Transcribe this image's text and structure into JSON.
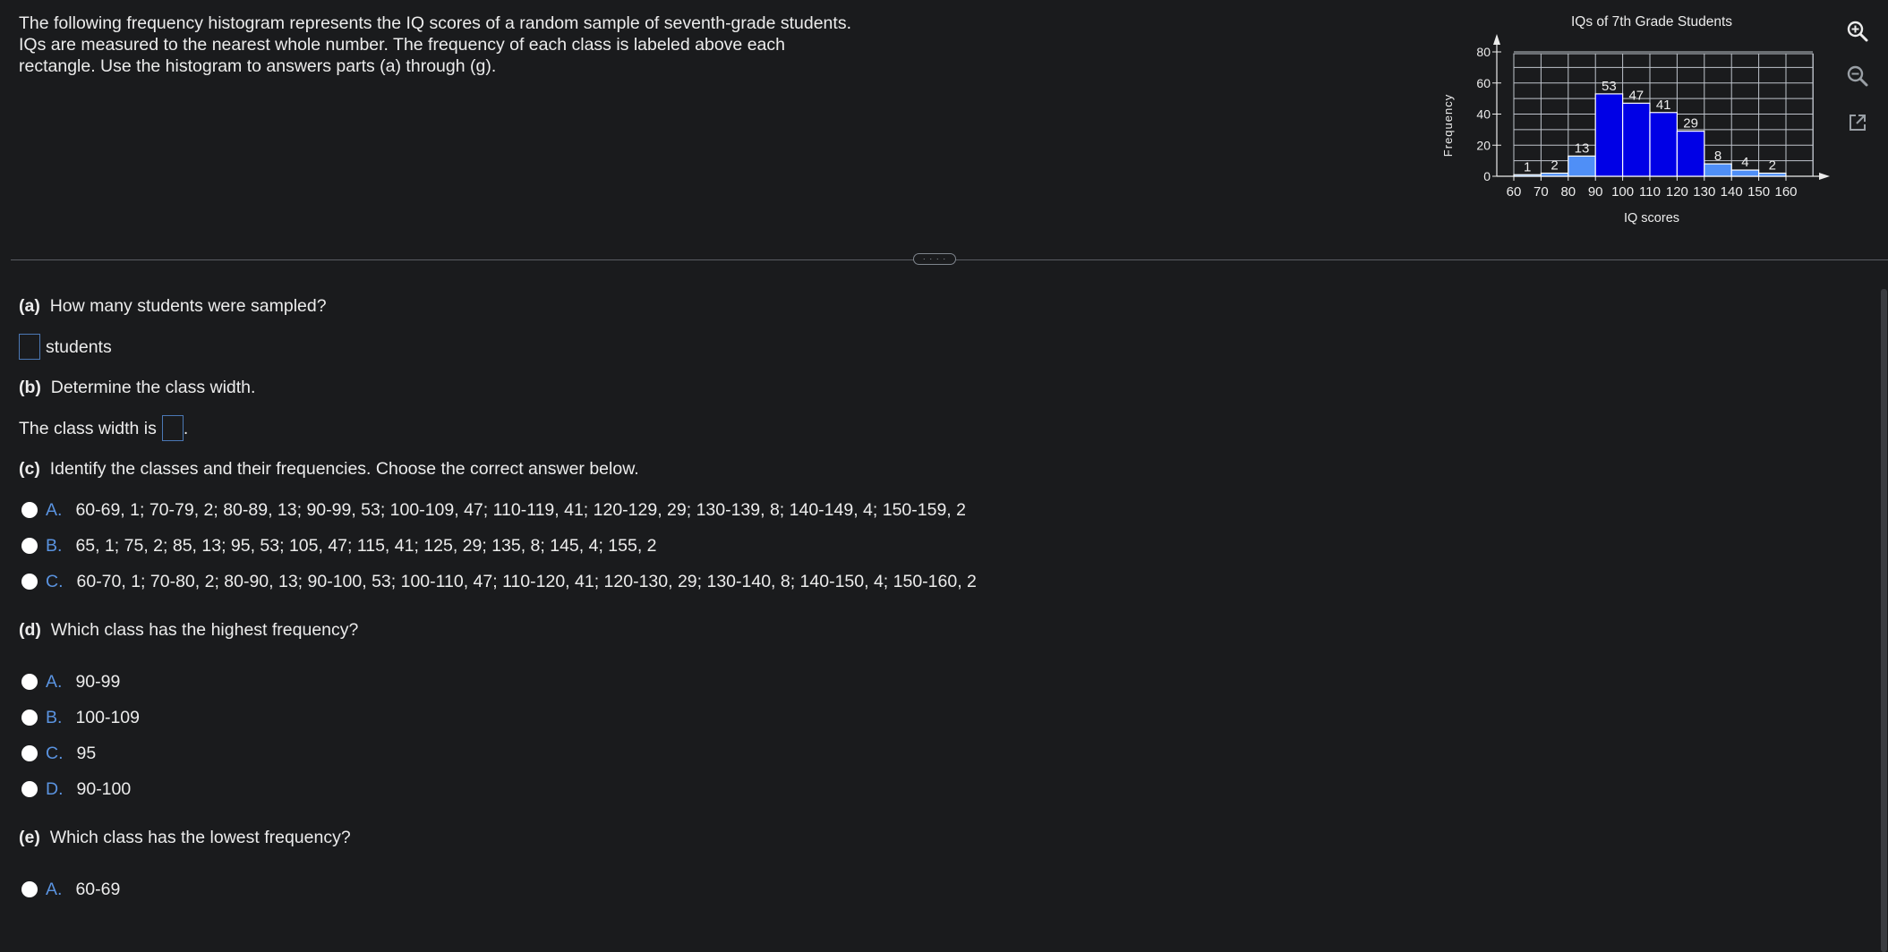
{
  "intro": {
    "line1": "The following frequency histogram represents the IQ scores of a random sample of seventh-grade students.",
    "line2": "IQs are measured to the nearest whole number. The frequency of each class is labeled above each",
    "line3": "rectangle. Use the histogram to answers parts (a) through (g)."
  },
  "chart_data": {
    "type": "bar",
    "title": "IQs of 7th Grade Students",
    "xlabel": "IQ scores",
    "ylabel": "Frequency",
    "x_ticks": [
      "60",
      "70",
      "80",
      "90",
      "100",
      "110",
      "120",
      "130",
      "140",
      "150",
      "160"
    ],
    "y_ticks": [
      "0",
      "20",
      "40",
      "60",
      "80"
    ],
    "ylim": [
      0,
      80
    ],
    "xlim": [
      60,
      160
    ],
    "class_width": 10,
    "bins": [
      {
        "start": 60,
        "end": 70,
        "value": 1,
        "label": "1"
      },
      {
        "start": 70,
        "end": 80,
        "value": 2,
        "label": "2"
      },
      {
        "start": 80,
        "end": 90,
        "value": 13,
        "label": "13"
      },
      {
        "start": 90,
        "end": 100,
        "value": 53,
        "label": "53"
      },
      {
        "start": 100,
        "end": 110,
        "value": 47,
        "label": "47"
      },
      {
        "start": 110,
        "end": 120,
        "value": 41,
        "label": "41"
      },
      {
        "start": 120,
        "end": 130,
        "value": 29,
        "label": "29"
      },
      {
        "start": 130,
        "end": 140,
        "value": 8,
        "label": "8"
      },
      {
        "start": 140,
        "end": 150,
        "value": 4,
        "label": "4"
      },
      {
        "start": 150,
        "end": 160,
        "value": 2,
        "label": "2"
      }
    ],
    "grid": true,
    "colors": {
      "dark_bar": "#0000e6",
      "light_bar": "#4f8ff7",
      "bar_border": "#ffffff",
      "grid": "#bfc4cc"
    }
  },
  "tools": {
    "zoom_in": "zoom-in-icon",
    "zoom_out": "zoom-out-icon",
    "popout": "external-link-icon"
  },
  "parts": {
    "a": {
      "tag": "(a)",
      "question": "How many students were sampled?",
      "unit": "students"
    },
    "b": {
      "tag": "(b)",
      "question": "Determine the class width.",
      "prefix": "The class width is",
      "suffix": "."
    },
    "c": {
      "tag": "(c)",
      "question": "Identify the classes and their frequencies. Choose the correct answer below.",
      "options": [
        {
          "letter": "A.",
          "text": "60-69, 1; 70-79, 2; 80-89, 13; 90-99, 53; 100-109, 47; 110-119, 41; 120-129, 29; 130-139, 8; 140-149, 4; 150-159, 2"
        },
        {
          "letter": "B.",
          "text": "65, 1; 75, 2; 85, 13; 95, 53; 105, 47; 115, 41; 125, 29; 135, 8; 145, 4; 155, 2"
        },
        {
          "letter": "C.",
          "text": "60-70, 1; 70-80, 2; 80-90, 13; 90-100, 53; 100-110, 47; 110-120, 41; 120-130, 29; 130-140, 8; 140-150, 4; 150-160, 2"
        }
      ]
    },
    "d": {
      "tag": "(d)",
      "question": "Which class has the highest frequency?",
      "options": [
        {
          "letter": "A.",
          "text": "90-99"
        },
        {
          "letter": "B.",
          "text": "100-109"
        },
        {
          "letter": "C.",
          "text": "95"
        },
        {
          "letter": "D.",
          "text": "90-100"
        }
      ]
    },
    "e": {
      "tag": "(e)",
      "question": "Which class has the lowest frequency?",
      "options": [
        {
          "letter": "A.",
          "text": "60-69"
        }
      ]
    }
  },
  "divider": {
    "handle_text": "· · · ·"
  }
}
